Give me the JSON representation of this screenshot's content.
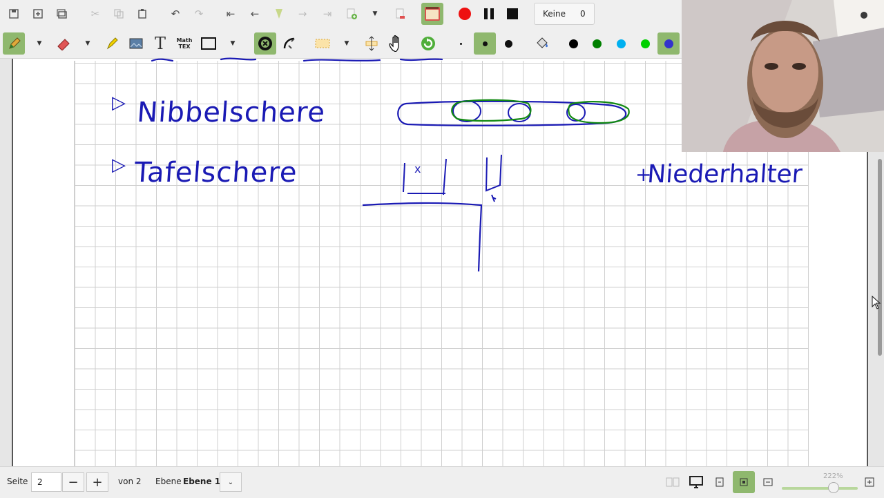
{
  "toolbar": {
    "recording": {
      "layer_select": "Keine",
      "count": "0"
    },
    "tex_label_top": "Math",
    "tex_label_bottom": "TEX",
    "colors": [
      "#000000",
      "#008000",
      "#00b0f0",
      "#00d000",
      "#3333cc"
    ]
  },
  "document": {
    "handwriting": {
      "line1_bullet": "▷",
      "line1_text": "Nibbelschere",
      "line2_bullet": "▷",
      "line2_text": "Tafelschere",
      "note_mark": "+",
      "note_text": "Niederhalter"
    }
  },
  "statusbar": {
    "page_label": "Seite",
    "page_value": "2",
    "minus": "−",
    "plus": "+",
    "of_pages": "von 2",
    "layer_label": "Ebene",
    "layer_value": "Ebene 1",
    "zoom": "222%"
  }
}
